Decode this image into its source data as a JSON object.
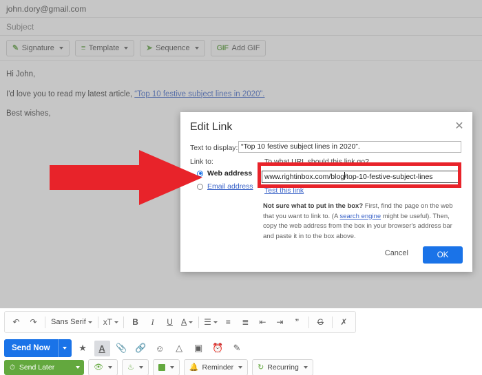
{
  "compose": {
    "to": "john.dory@gmail.com",
    "subject_placeholder": "Subject",
    "toolbar": [
      {
        "label": "Signature",
        "icon": "signature-icon"
      },
      {
        "label": "Template",
        "icon": "template-icon"
      },
      {
        "label": "Sequence",
        "icon": "sequence-icon"
      },
      {
        "label": "Add GIF",
        "icon": "gif-icon"
      }
    ],
    "body": {
      "greeting": "Hi John,",
      "line_prefix": "I'd love you to read my latest article, ",
      "link_text": "“Top 10 festive subject lines in 2020”.",
      "signoff": "Best wishes,"
    }
  },
  "format_bar": {
    "undo": "undo-icon",
    "redo": "redo-icon",
    "font": "Sans Serif",
    "size": "size-icon",
    "bold": "B",
    "italic": "I",
    "underline": "U",
    "text_color": "A",
    "align": "align-icon",
    "numbered_list": "numbered-list-icon",
    "bulleted_list": "bulleted-list-icon",
    "indent_less": "indent-less-icon",
    "indent_more": "indent-more-icon",
    "quote": "”",
    "strikethrough": "G",
    "remove_format": "remove-format-icon"
  },
  "send_row": {
    "send_now": "Send Now",
    "icons": [
      "dropbox-icon",
      "format-text-icon",
      "attach-icon",
      "insert-link-icon",
      "emoji-icon",
      "drive-icon",
      "insert-photo-icon",
      "confidential-icon",
      "signature-pen-icon"
    ]
  },
  "green_row": {
    "send_later": "Send Later",
    "buttons": [
      {
        "label": "",
        "icon": "tracking-eye-icon"
      },
      {
        "label": "",
        "icon": "puzzle-icon"
      },
      {
        "label": "",
        "icon": "note-icon"
      },
      {
        "label": "Reminder",
        "icon": "reminder-bell-icon"
      },
      {
        "label": "Recurring",
        "icon": "recurring-icon"
      }
    ]
  },
  "modal": {
    "title": "Edit Link",
    "close": "✕",
    "text_to_display_label": "Text to display:",
    "text_to_display_value": "“Top 10 festive subject lines in 2020”.",
    "link_to_label": "Link to:",
    "url_hint": "To what URL should this link go?",
    "options": [
      {
        "label": "Web address",
        "selected": true
      },
      {
        "label": "Email address",
        "selected": false
      }
    ],
    "url_value_before_caret": "www.rightinbox.com/blog",
    "url_value_after_caret": "/top-10-festive-subject-lines",
    "test_link": "Test this link",
    "help_bold": "Not sure what to put in the box?",
    "help_part1": " First, find the page on the web that you want to link to. (A ",
    "help_link": "search engine",
    "help_part2": " might be useful). Then, copy the web address from the box in your browser's address bar and paste it in to the box above.",
    "cancel": "Cancel",
    "ok": "OK"
  },
  "annotations": {
    "arrow_color": "#e8232a",
    "box_color": "#e8232a"
  }
}
